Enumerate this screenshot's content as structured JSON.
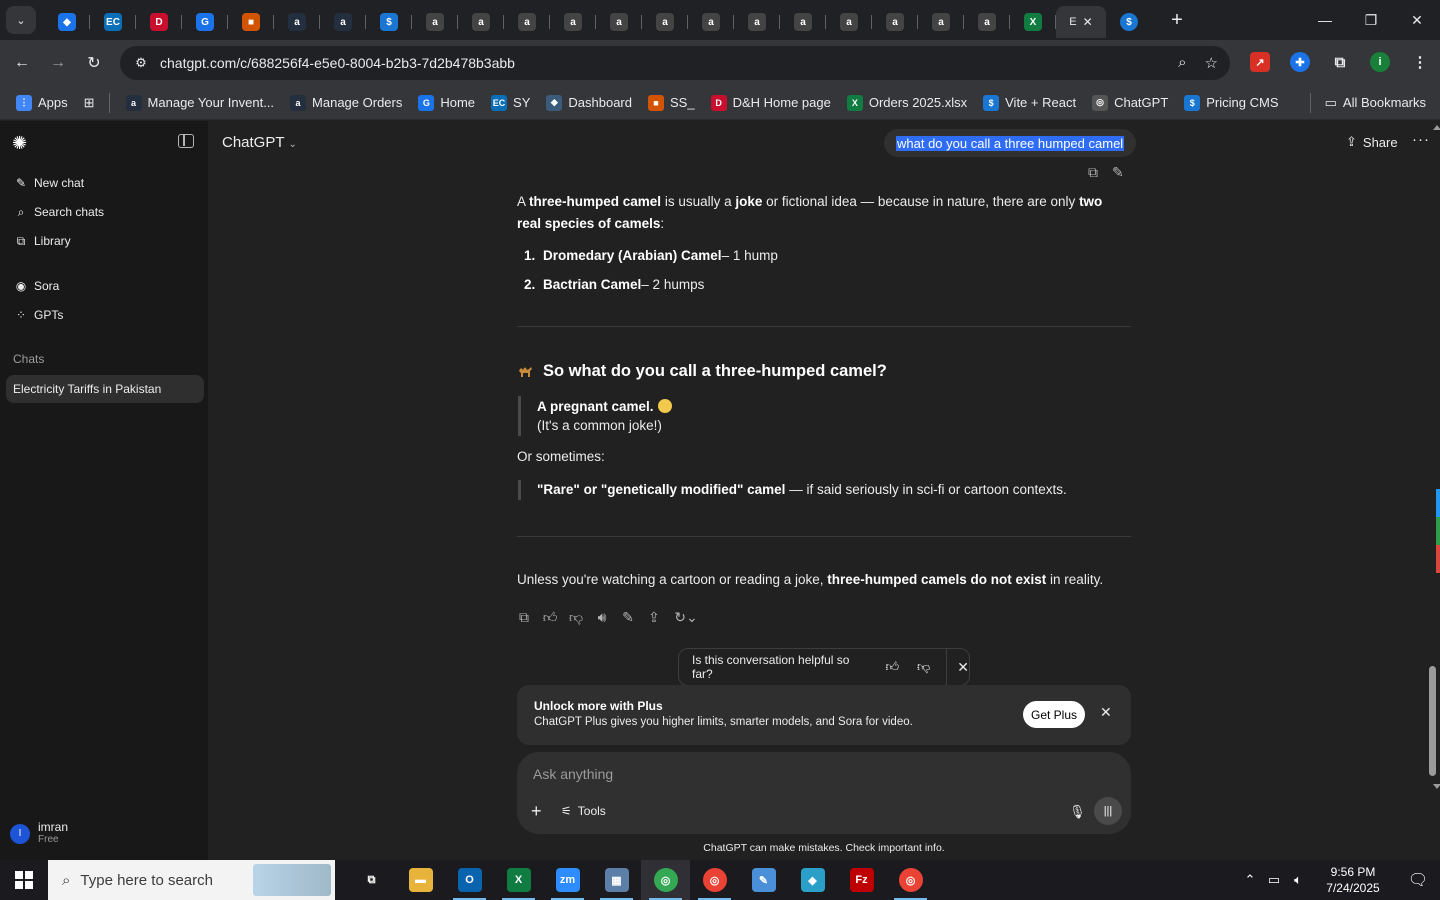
{
  "browser": {
    "url": "chatgpt.com/c/688256f4-e5e0-8004-b2b3-7d2b478b3abb",
    "tabs": [
      {
        "icon": "pin-icon",
        "color": "#1a73e8",
        "glyph": "◆"
      },
      {
        "icon": "ec-icon",
        "color": "#0b6fb8",
        "glyph": "EC"
      },
      {
        "icon": "dh-icon",
        "color": "#c8102e",
        "glyph": "D"
      },
      {
        "icon": "doc-icon",
        "color": "#1a73e8",
        "glyph": "G"
      },
      {
        "icon": "box-icon",
        "color": "#d35400",
        "glyph": "■"
      },
      {
        "icon": "amazon-icon",
        "color": "#232f3e",
        "glyph": "a"
      },
      {
        "icon": "amazon-icon",
        "color": "#232f3e",
        "glyph": "a"
      },
      {
        "icon": "dollar-icon",
        "color": "#1976d2",
        "glyph": "$"
      },
      {
        "icon": "amazon-icon",
        "color": "#444",
        "glyph": "a"
      },
      {
        "icon": "amazon-icon",
        "color": "#444",
        "glyph": "a"
      },
      {
        "icon": "amazon-icon",
        "color": "#444",
        "glyph": "a"
      },
      {
        "icon": "amazon-icon",
        "color": "#444",
        "glyph": "a"
      },
      {
        "icon": "amazon-icon",
        "color": "#444",
        "glyph": "a"
      },
      {
        "icon": "amazon-icon",
        "color": "#444",
        "glyph": "a"
      },
      {
        "icon": "amazon-icon",
        "color": "#444",
        "glyph": "a"
      },
      {
        "icon": "amazon-icon",
        "color": "#444",
        "glyph": "a"
      },
      {
        "icon": "amazon-icon",
        "color": "#444",
        "glyph": "a"
      },
      {
        "icon": "amazon-icon",
        "color": "#444",
        "glyph": "a"
      },
      {
        "icon": "amazon-icon",
        "color": "#444",
        "glyph": "a"
      },
      {
        "icon": "amazon-icon",
        "color": "#444",
        "glyph": "a"
      },
      {
        "icon": "amazon-icon",
        "color": "#444",
        "glyph": "a"
      },
      {
        "icon": "excel-icon",
        "color": "#107c41",
        "glyph": "X"
      }
    ],
    "active_tab_glyph": "E",
    "extra_tab_glyph": "$",
    "bookmarks": [
      {
        "label": "Apps",
        "color": "#4285f4",
        "glyph": "⋮"
      },
      {
        "label": "Manage Your Invent...",
        "color": "#232f3e",
        "glyph": "a"
      },
      {
        "label": "Manage Orders",
        "color": "#232f3e",
        "glyph": "a"
      },
      {
        "label": "Home",
        "color": "#1a73e8",
        "glyph": "G"
      },
      {
        "label": "SY",
        "color": "#0b6fb8",
        "glyph": "EC"
      },
      {
        "label": "Dashboard",
        "color": "#3b5b7a",
        "glyph": "◆"
      },
      {
        "label": "SS_",
        "color": "#d35400",
        "glyph": "■"
      },
      {
        "label": "D&H Home page",
        "color": "#c8102e",
        "glyph": "D"
      },
      {
        "label": "Orders 2025.xlsx",
        "color": "#107c41",
        "glyph": "X"
      },
      {
        "label": "Vite + React",
        "color": "#1976d2",
        "glyph": "$"
      },
      {
        "label": "ChatGPT",
        "color": "#555",
        "glyph": "◎"
      },
      {
        "label": "Pricing CMS",
        "color": "#1976d2",
        "glyph": "$"
      }
    ],
    "all_bookmarks": "All Bookmarks"
  },
  "sidebar": {
    "nav": [
      {
        "label": "New chat",
        "icon": "edit-icon",
        "glyph": "✎"
      },
      {
        "label": "Search chats",
        "icon": "search-icon",
        "glyph": "⌕"
      },
      {
        "label": "Library",
        "icon": "library-icon",
        "glyph": "⧉"
      }
    ],
    "nav2": [
      {
        "label": "Sora",
        "icon": "sora-icon",
        "glyph": "◉"
      },
      {
        "label": "GPTs",
        "icon": "gpts-icon",
        "glyph": "⁘"
      }
    ],
    "section": "Chats",
    "chats": [
      "Electricity Tariffs in Pakistan"
    ],
    "user": {
      "initial": "I",
      "name": "imran",
      "plan": "Free"
    }
  },
  "header": {
    "model": "ChatGPT",
    "share": "Share"
  },
  "conversation": {
    "user_message": "what do you call a three humped camel",
    "intro_pre": "A ",
    "intro_b1": "three-humped camel",
    "intro_mid": " is usually a ",
    "intro_b2": "joke",
    "intro_mid2": " or fictional idea — because in nature, there are only ",
    "intro_b3": "two real species of camels",
    "intro_end": ":",
    "list": [
      {
        "num": "1.",
        "name": "Dromedary (Arabian) Camel",
        "detail": " – 1 hump"
      },
      {
        "num": "2.",
        "name": "Bactrian Camel",
        "detail": " – 2 humps"
      }
    ],
    "heading": "So what do you call a three-humped camel?",
    "quote1_bold": "A pregnant camel.",
    "quote1_line2": "(It's a common joke!)",
    "or_sometimes": "Or sometimes:",
    "quote2_bold": "\"Rare\" or \"genetically modified\" camel",
    "quote2_rest": " — if said seriously in sci-fi or cartoon contexts.",
    "closing_pre": "Unless you're watching a cartoon or reading a joke, ",
    "closing_bold": "three-humped camels do not exist",
    "closing_end": " in reality."
  },
  "feedback": {
    "question": "Is this conversation helpful so far?"
  },
  "upsell": {
    "title": "Unlock more with Plus",
    "desc": "ChatGPT Plus gives you higher limits, smarter models, and Sora for video.",
    "button": "Get Plus"
  },
  "composer": {
    "placeholder": "Ask anything",
    "tools": "Tools",
    "disclaimer": "ChatGPT can make mistakes. Check important info."
  },
  "taskbar": {
    "search_placeholder": "Type here to search",
    "apps": [
      {
        "icon": "task-view-icon",
        "color": "transparent",
        "glyph": "⧉"
      },
      {
        "icon": "file-explorer-icon",
        "color": "#e8b33b",
        "glyph": "▬"
      },
      {
        "icon": "outlook-icon",
        "color": "#0a64ad",
        "glyph": "O"
      },
      {
        "icon": "excel-icon",
        "color": "#107c41",
        "glyph": "X"
      },
      {
        "icon": "zoom-icon",
        "color": "#2d8cff",
        "glyph": "zm"
      },
      {
        "icon": "calculator-icon",
        "color": "#5b7fa6",
        "glyph": "▦"
      },
      {
        "icon": "chrome-icon",
        "color": "#34a853",
        "glyph": "◎"
      },
      {
        "icon": "chrome-icon",
        "color": "#ea4335",
        "glyph": "◎"
      },
      {
        "icon": "notes-icon",
        "color": "#4a90d9",
        "glyph": "✎"
      },
      {
        "icon": "app-icon",
        "color": "#2aa0c8",
        "glyph": "◆"
      },
      {
        "icon": "filezilla-icon",
        "color": "#bf0000",
        "glyph": "Fz"
      },
      {
        "icon": "chrome-icon",
        "color": "#ea4335",
        "glyph": "◎"
      }
    ],
    "time": "9:56 PM",
    "date": "7/24/2025"
  },
  "colors": {
    "accent_selection": "#2f6df6",
    "sidebar_bg": "#181818",
    "main_bg": "#212121"
  }
}
